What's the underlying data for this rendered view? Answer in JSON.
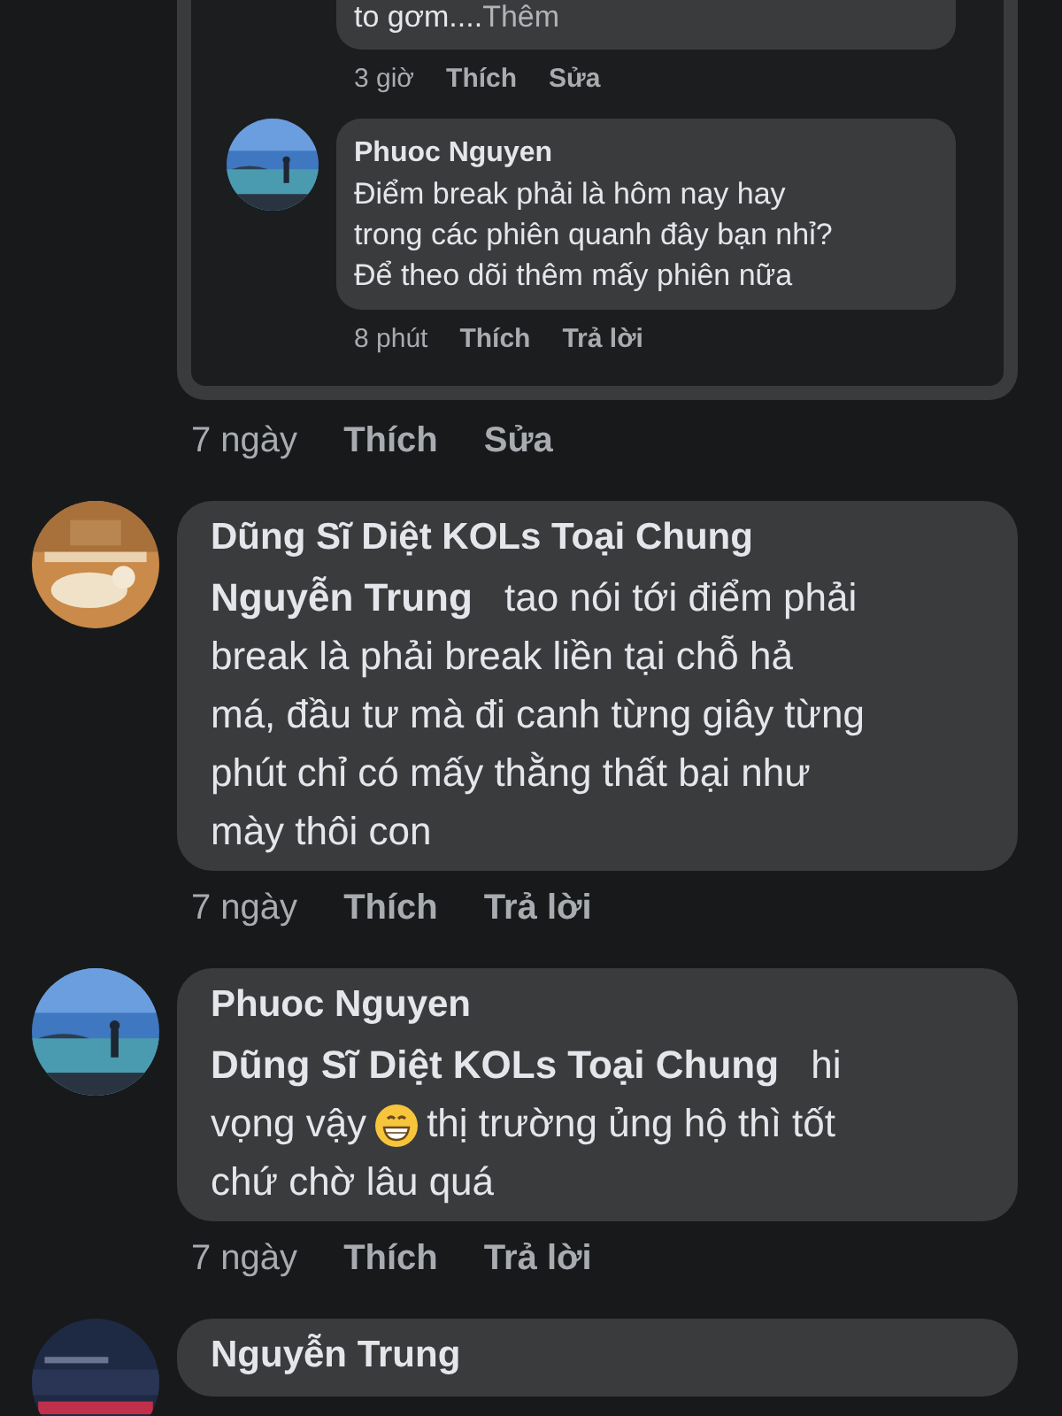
{
  "embedded_thread": {
    "truncated_comment": {
      "text": "to gơm....",
      "more_link": "Thêm",
      "time": "3 giờ",
      "links": [
        "Thích",
        "Sửa"
      ]
    },
    "reply": {
      "author": "Phuoc Nguyen",
      "lines": [
        [
          {
            "kind": "text",
            "text": "Điểm break phải là hôm nay hay"
          }
        ],
        [
          {
            "kind": "text",
            "text": "trong các phiên quanh đây bạn nhỉ?"
          }
        ],
        [
          {
            "kind": "text",
            "text": "Để theo dõi thêm mấy phiên nữa"
          }
        ]
      ],
      "time": "8 phút",
      "links": [
        "Thích",
        "Trả lời"
      ]
    }
  },
  "thread_actions": {
    "time": "7 ngày",
    "links": [
      "Thích",
      "Sửa"
    ]
  },
  "comments": [
    {
      "author": "Dũng Sĩ Diệt KOLs Toại Chung",
      "lines": [
        [
          {
            "kind": "mention",
            "text": "Nguyễn Trung"
          },
          {
            "kind": "text",
            "text": "tao nói tới điểm phải"
          }
        ],
        [
          {
            "kind": "text",
            "text": "break là phải break liền tại chỗ hả"
          }
        ],
        [
          {
            "kind": "text",
            "text": "má, đầu tư mà đi canh từng giây từng"
          }
        ],
        [
          {
            "kind": "text",
            "text": "phút chỉ có mấy thằng thất bại như"
          }
        ],
        [
          {
            "kind": "text",
            "text": "mày thôi con"
          }
        ]
      ],
      "time": "7 ngày",
      "links": [
        "Thích",
        "Trả lời"
      ]
    },
    {
      "author": "Phuoc Nguyen",
      "lines": [
        [
          {
            "kind": "mention",
            "text": "Dũng Sĩ Diệt KOLs Toại Chung"
          },
          {
            "kind": "text",
            "text": "hi"
          }
        ],
        [
          {
            "kind": "text",
            "text": "vọng vậy"
          },
          {
            "kind": "emoji"
          },
          {
            "kind": "text",
            "text": "thị trường ủng hộ thì tốt"
          }
        ],
        [
          {
            "kind": "text",
            "text": "chứ chờ lâu quá"
          }
        ]
      ],
      "time": "7 ngày",
      "links": [
        "Thích",
        "Trả lời"
      ]
    },
    {
      "author": "Nguyễn Trung"
    }
  ]
}
